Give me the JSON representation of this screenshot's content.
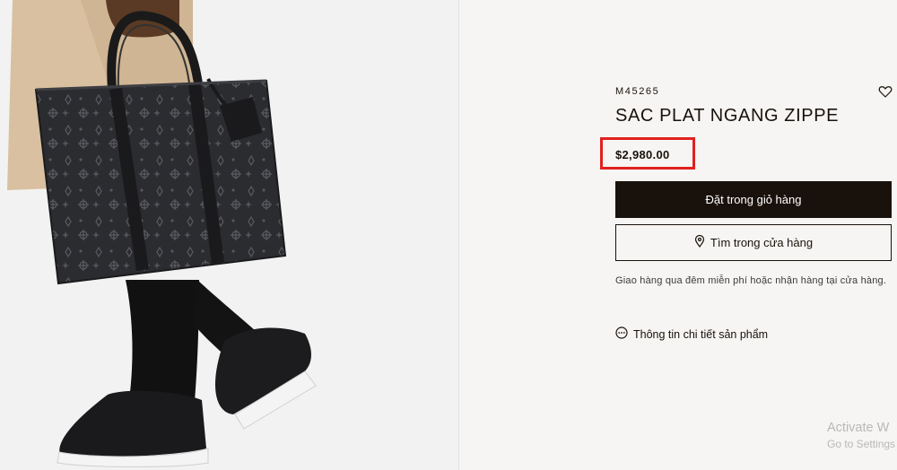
{
  "product": {
    "sku": "M45265",
    "name": "SAC PLAT NGANG ZIPPE",
    "price": "$2,980.00",
    "add_to_cart_label": "Đặt trong giỏ hàng",
    "find_in_store_label": "Tìm trong cửa hàng",
    "delivery_note": "Giao hàng qua đêm miễn phí hoặc nhận hàng tại cửa hàng.",
    "details_label": "Thông tin chi tiết sản phẩm"
  },
  "icons": {
    "wishlist": "heart-outline-icon",
    "store": "location-pin-icon",
    "details": "more-circle-icon"
  },
  "colors": {
    "primary": "#19110b",
    "highlight": "#e0211f",
    "background": "#f6f5f3"
  },
  "system_overlay": {
    "line1": "Activate W",
    "line2": "Go to Settings"
  }
}
